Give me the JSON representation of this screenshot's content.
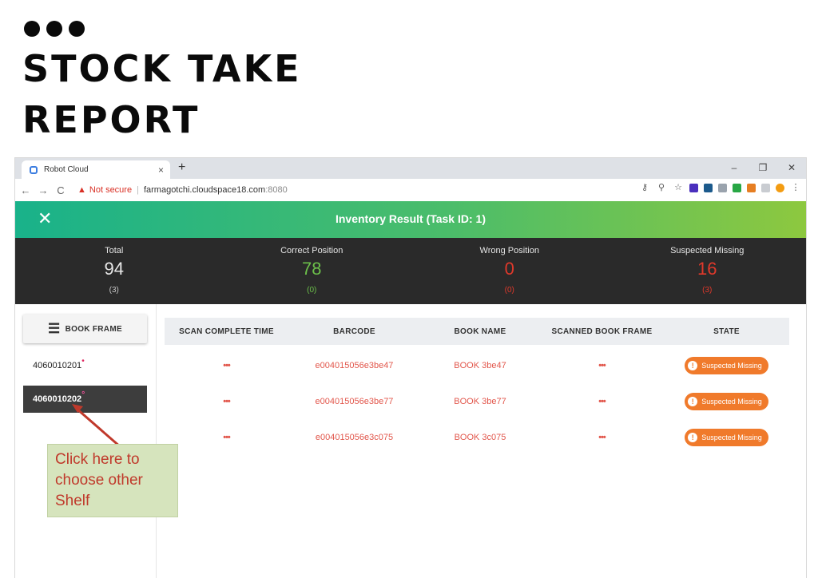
{
  "slide": {
    "title_line1": "STOCK TAKE",
    "title_line2": "REPORT"
  },
  "browser": {
    "tab_title": "Robot Cloud",
    "tab_close": "×",
    "new_tab": "+",
    "window_controls": [
      "–",
      "❐",
      "✕"
    ],
    "nav": [
      "←",
      "→",
      "C"
    ],
    "security_label": "Not secure",
    "url_host": "farmagotchi.cloudspace18.com",
    "url_port": ":8080"
  },
  "app": {
    "close_glyph": "✕",
    "header_title": "Inventory Result (Task ID: 1)"
  },
  "stats": [
    {
      "label": "Total",
      "value": "94",
      "sub": "(3)",
      "color": "#e8e8e8",
      "sub_color": "#c8c8c8"
    },
    {
      "label": "Correct Position",
      "value": "78",
      "sub": "(0)",
      "color": "#6cc04a",
      "sub_color": "#6cc04a"
    },
    {
      "label": "Wrong Position",
      "value": "0",
      "sub": "(0)",
      "color": "#e0392b",
      "sub_color": "#e0392b"
    },
    {
      "label": "Suspected Missing",
      "value": "16",
      "sub": "(3)",
      "color": "#e0392b",
      "sub_color": "#e0392b"
    }
  ],
  "sidebar": {
    "book_frame_label": "BOOK FRAME",
    "shelves": [
      {
        "id": "4060010201",
        "active": false
      },
      {
        "id": "4060010202",
        "active": true
      }
    ]
  },
  "table": {
    "headers": [
      "SCAN COMPLETE TIME",
      "BARCODE",
      "BOOK NAME",
      "SCANNED BOOK FRAME",
      "STATE"
    ],
    "rows": [
      {
        "time": "•••",
        "barcode": "e004015056e3be47",
        "book": "BOOK 3be47",
        "frame": "•••",
        "state": "Suspected Missing"
      },
      {
        "time": "•••",
        "barcode": "e004015056e3be77",
        "book": "BOOK 3be77",
        "frame": "•••",
        "state": "Suspected Missing"
      },
      {
        "time": "•••",
        "barcode": "e004015056e3c075",
        "book": "BOOK 3c075",
        "frame": "•••",
        "state": "Suspected Missing"
      }
    ]
  },
  "annotation": {
    "lines": [
      "Click here to",
      "choose other",
      "Shelf"
    ]
  }
}
